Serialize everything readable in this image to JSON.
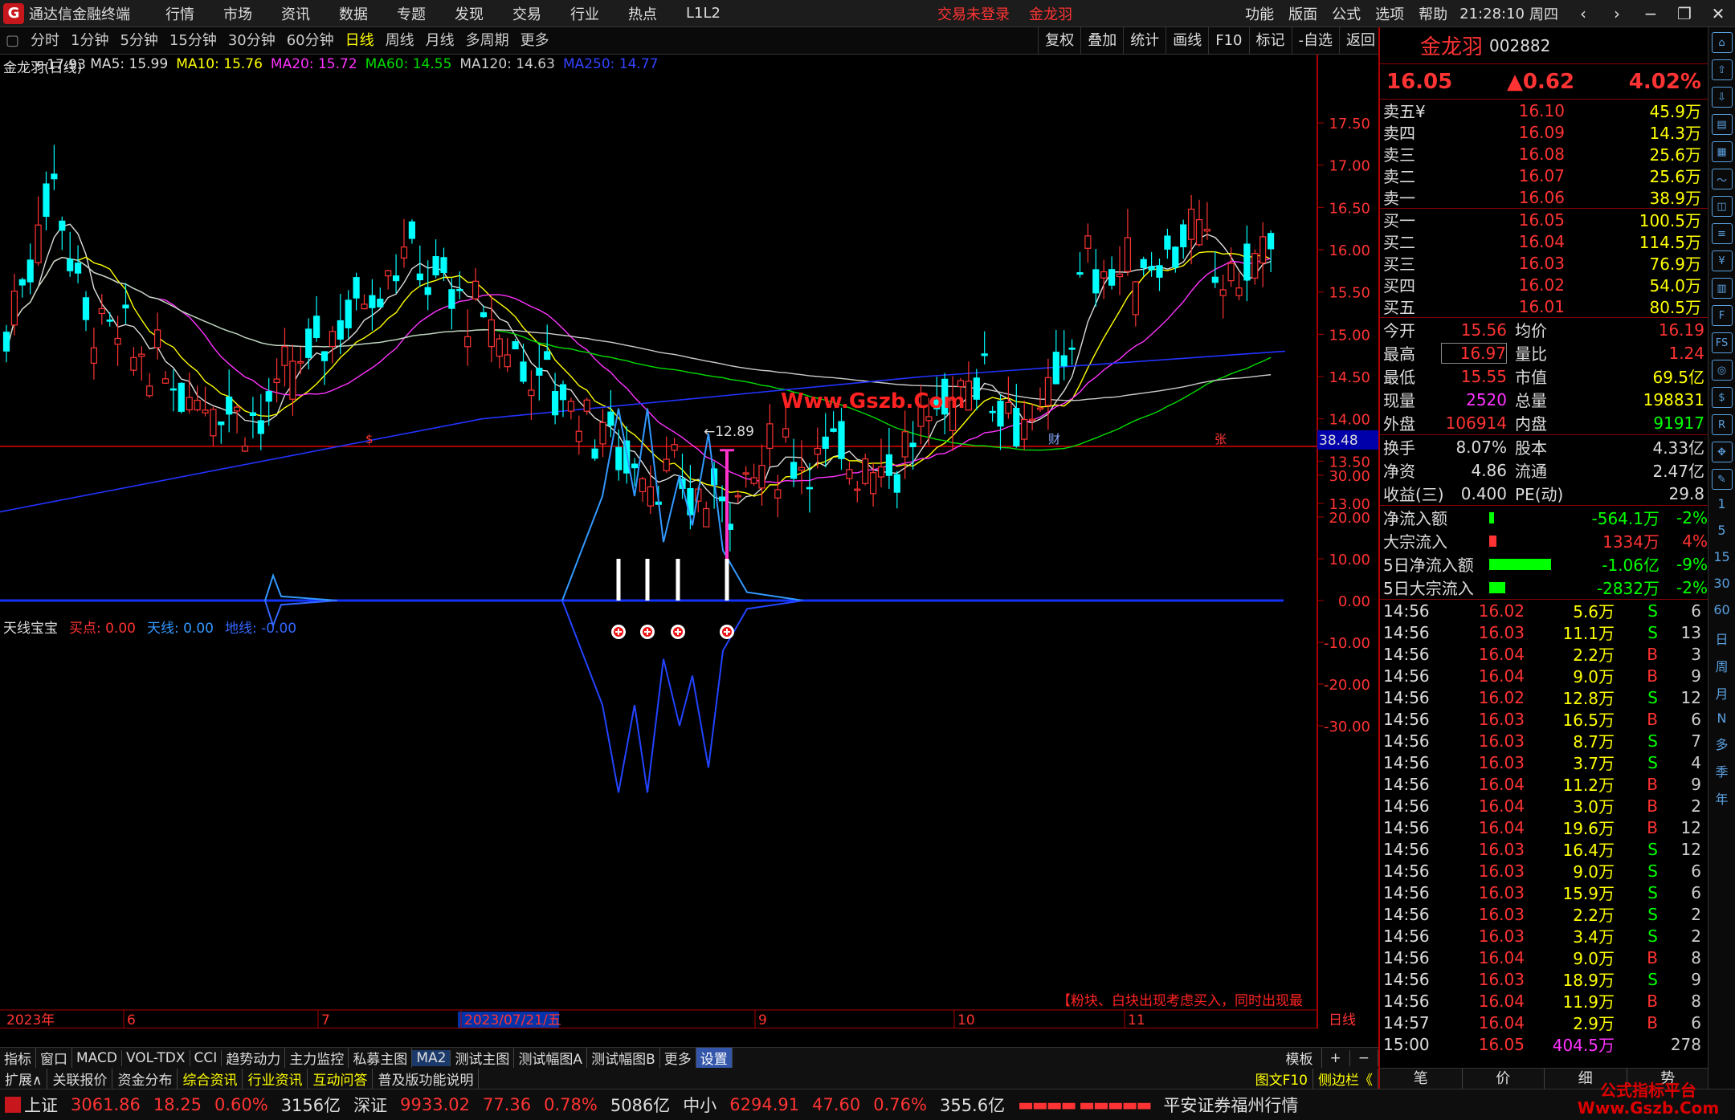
{
  "titlebar": {
    "app_name": "通达信金融终端",
    "menu": [
      "行情",
      "市场",
      "资讯",
      "数据",
      "专题",
      "发现",
      "交易",
      "行业",
      "热点",
      "L1L2"
    ],
    "alert": "交易未登录",
    "stock": "金龙羽",
    "right": [
      "功能",
      "版面",
      "公式",
      "选项",
      "帮助"
    ],
    "time": "21:28:10",
    "weekday": "周四"
  },
  "toolbar": {
    "periods": [
      "分时",
      "1分钟",
      "5分钟",
      "15分钟",
      "30分钟",
      "60分钟",
      "日线",
      "周线",
      "月线",
      "多周期",
      "更多"
    ],
    "active": "日线",
    "buttons": [
      "复权",
      "叠加",
      "统计",
      "画线",
      "F10",
      "标记",
      "-自选",
      "返回"
    ]
  },
  "legend": {
    "title": "金龙羽(日线)",
    "ma5": "MA5: 15.99",
    "ma10": "MA10: 15.76",
    "ma20": "MA20: 15.72",
    "ma60": "MA60: 14.55",
    "ma120": "MA120: 14.63",
    "ma250": "MA250: 14.77"
  },
  "legend2": {
    "title": "天线宝宝",
    "buy": "买点: 0.00",
    "sky": "天线: 0.00",
    "ground": "地线: -0.00"
  },
  "chart": {
    "hi_label": "17.93",
    "lo_label": "12.89",
    "watermark": "Www.Gszb.Com",
    "price_ticks": [
      "17.50",
      "17.00",
      "16.50",
      "16.00",
      "15.50",
      "15.00",
      "14.50",
      "14.00",
      "13.50",
      "13.00"
    ],
    "ind_ticks": [
      "30.00",
      "20.00",
      "10.00",
      "0.00",
      "-10.00",
      "-20.00",
      "-30.00"
    ],
    "ind_cursor": "38.48",
    "note": "【粉块、白块出现考虑买入，同时出现最",
    "date_labels": [
      "2023年",
      "6",
      "7",
      "2023/07/21/五",
      "9",
      "10",
      "11",
      "日线"
    ],
    "markers": [
      "$",
      "财",
      "张"
    ]
  },
  "panel": {
    "name": "金龙羽",
    "code": "002882",
    "price": "16.05",
    "change": "▲0.62",
    "pct": "4.02%",
    "asks": [
      [
        "卖五",
        "16.10",
        "45.9万"
      ],
      [
        "卖四",
        "16.09",
        "14.3万"
      ],
      [
        "卖三",
        "16.08",
        "25.6万"
      ],
      [
        "卖二",
        "16.07",
        "25.6万"
      ],
      [
        "卖一",
        "16.06",
        "38.9万"
      ]
    ],
    "ask_symbol": "¥",
    "bids": [
      [
        "买一",
        "16.05",
        "100.5万"
      ],
      [
        "买二",
        "16.04",
        "114.5万"
      ],
      [
        "买三",
        "16.03",
        "76.9万"
      ],
      [
        "买四",
        "16.02",
        "54.0万"
      ],
      [
        "买五",
        "16.01",
        "80.5万"
      ]
    ],
    "stats": [
      [
        "今开",
        "15.56",
        "均价",
        "16.19"
      ],
      [
        "最高",
        "16.97",
        "量比",
        "1.24"
      ],
      [
        "最低",
        "15.55",
        "市值",
        "69.5亿"
      ],
      [
        "现量",
        "2520",
        "总量",
        "198831"
      ],
      [
        "外盘",
        "106914",
        "内盘",
        "91917"
      ]
    ],
    "stats2": [
      [
        "换手",
        "8.07%",
        "股本",
        "4.33亿"
      ],
      [
        "净资",
        "4.86",
        "流通",
        "2.47亿"
      ],
      [
        "收益(三)",
        "0.400",
        "PE(动)",
        "29.8"
      ]
    ],
    "flows": [
      {
        "k": "净流入额",
        "v": "-564.1万",
        "p": "-2%",
        "w": 0.05,
        "c": "#00ff00"
      },
      {
        "k": "大宗流入",
        "v": "1334万",
        "p": "4%",
        "w": 0.08,
        "c": "#ff3333"
      },
      {
        "k": "5日净流入额",
        "v": "-1.06亿",
        "p": "-9%",
        "w": 0.7,
        "c": "#00ff00"
      },
      {
        "k": "5日大宗流入",
        "v": "-2832万",
        "p": "-2%",
        "w": 0.18,
        "c": "#00ff00"
      }
    ],
    "ticks": [
      [
        "14:56",
        "16.02",
        "5.6万",
        "S",
        "6"
      ],
      [
        "14:56",
        "16.03",
        "11.1万",
        "S",
        "13"
      ],
      [
        "14:56",
        "16.04",
        "2.2万",
        "B",
        "3"
      ],
      [
        "14:56",
        "16.04",
        "9.0万",
        "B",
        "9"
      ],
      [
        "14:56",
        "16.02",
        "12.8万",
        "S",
        "12"
      ],
      [
        "14:56",
        "16.03",
        "16.5万",
        "B",
        "6"
      ],
      [
        "14:56",
        "16.03",
        "8.7万",
        "S",
        "7"
      ],
      [
        "14:56",
        "16.03",
        "3.7万",
        "S",
        "4"
      ],
      [
        "14:56",
        "16.04",
        "11.2万",
        "B",
        "9"
      ],
      [
        "14:56",
        "16.04",
        "3.0万",
        "B",
        "2"
      ],
      [
        "14:56",
        "16.04",
        "19.6万",
        "B",
        "12"
      ],
      [
        "14:56",
        "16.03",
        "16.4万",
        "S",
        "12"
      ],
      [
        "14:56",
        "16.03",
        "9.0万",
        "S",
        "6"
      ],
      [
        "14:56",
        "16.03",
        "15.9万",
        "S",
        "6"
      ],
      [
        "14:56",
        "16.03",
        "2.2万",
        "S",
        "2"
      ],
      [
        "14:56",
        "16.03",
        "3.4万",
        "S",
        "2"
      ],
      [
        "14:56",
        "16.04",
        "9.0万",
        "B",
        "8"
      ],
      [
        "14:56",
        "16.03",
        "18.9万",
        "S",
        "9"
      ],
      [
        "14:56",
        "16.04",
        "11.9万",
        "B",
        "8"
      ],
      [
        "14:57",
        "16.04",
        "2.9万",
        "B",
        "6"
      ],
      [
        "15:00",
        "16.05",
        "404.5万",
        "",
        "278"
      ]
    ],
    "bottom_tabs": [
      "笔",
      "价",
      "细",
      "势"
    ]
  },
  "bottom": {
    "tabs1": [
      "指标",
      "窗口",
      "MACD",
      "VOL-TDX",
      "CCI",
      "趋势动力",
      "主力监控",
      "私募主图",
      "MA2",
      "测试主图",
      "测试幅图A",
      "测试幅图B",
      "更多",
      "设置"
    ],
    "right1": [
      "模板",
      "+",
      "−"
    ],
    "tabs2": [
      "扩展∧",
      "关联报价",
      "资金分布",
      "综合资讯",
      "行业资讯",
      "互动问答",
      "普及版功能说明"
    ],
    "right2": [
      "图文F10",
      "侧边栏《"
    ]
  },
  "status": {
    "sh_label": "上证",
    "sh": "3061.86",
    "sh_ch": "18.25",
    "sh_pct": "0.60%",
    "sh_amt": "3156亿",
    "sz_label": "深证",
    "sz": "9933.02",
    "sz_ch": "77.36",
    "sz_pct": "0.78%",
    "sz_amt": "5086亿",
    "zx_label": "中小",
    "zx": "6294.91",
    "zx_ch": "47.60",
    "zx_pct": "0.76%",
    "zx_amt": "355.6亿",
    "broker": "平安证券福州行情",
    "watermark": "公式指标平台\nWww.Gszb.Com"
  },
  "icons": [
    "arrow-up-icon",
    "upload-icon",
    "down-icon",
    "doc-icon",
    "chart-icon",
    "line-icon",
    "kline-icon",
    "list-icon",
    "fund-icon",
    "doc2-icon",
    "f10-icon",
    "fs-icon",
    "orbit-icon",
    "dollar-icon",
    "rsi-icon",
    "nav-icon",
    "pen-icon"
  ],
  "periods": [
    "日",
    "周",
    "月",
    "N",
    "多",
    "季",
    "年"
  ],
  "side_numbers": [
    "1",
    "5",
    "15",
    "30",
    "60"
  ]
}
